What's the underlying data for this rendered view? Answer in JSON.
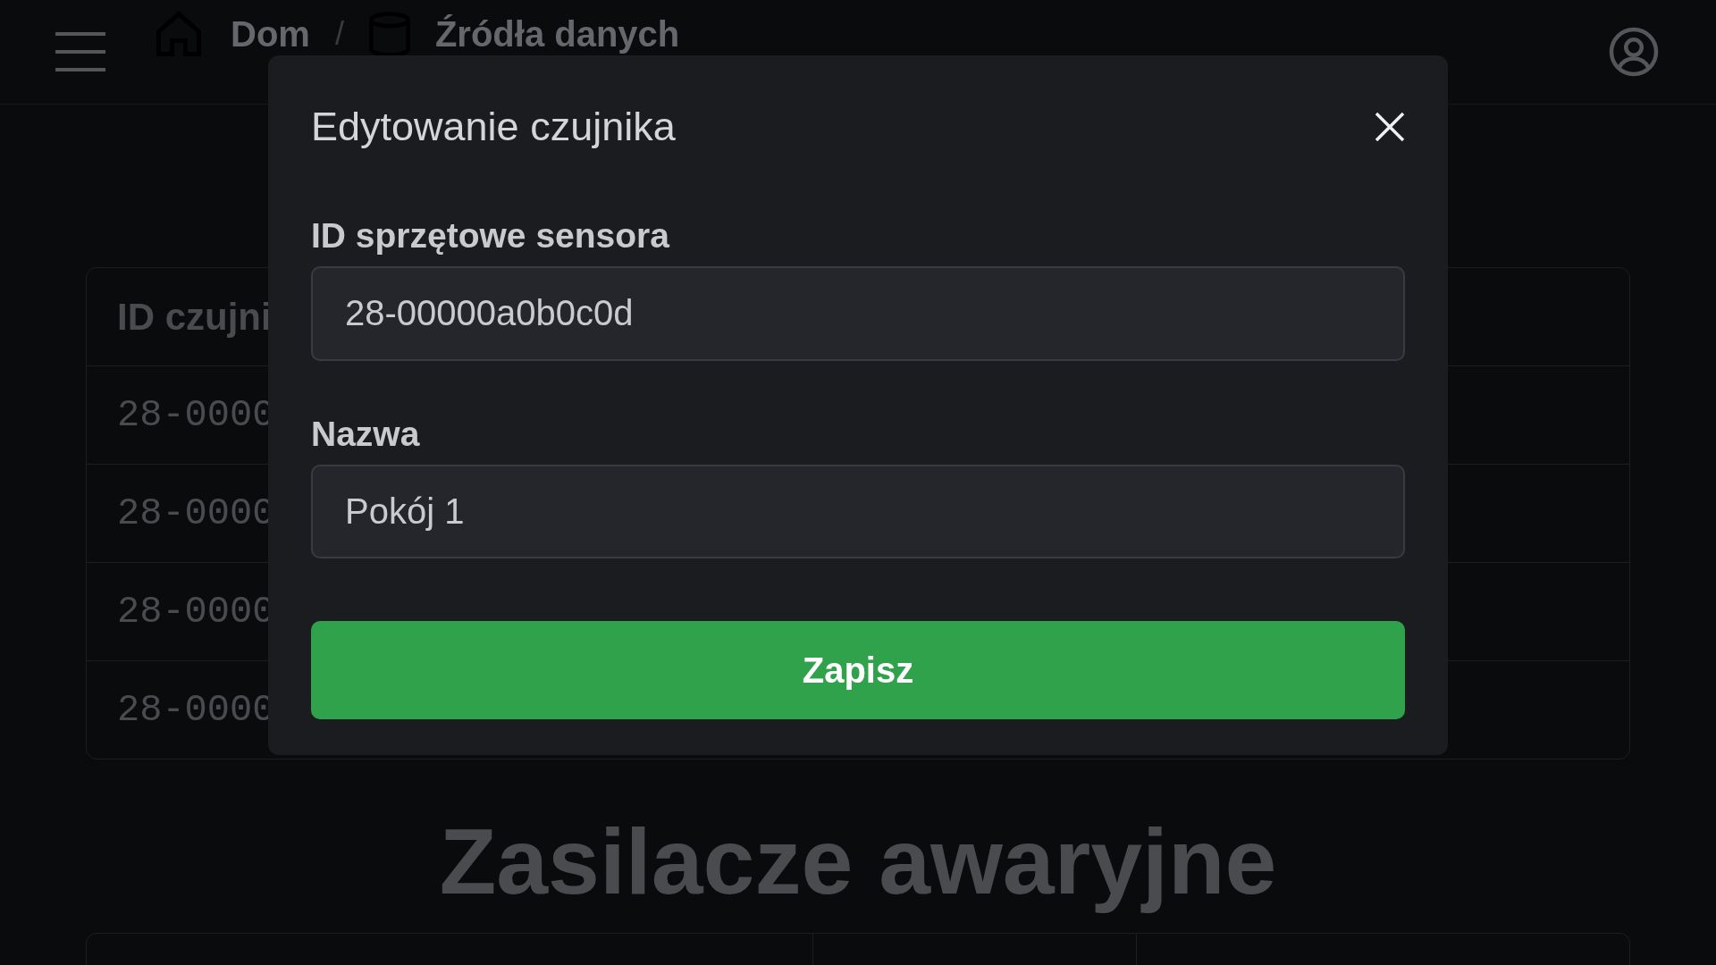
{
  "top_bar": {
    "separator": "/",
    "breadcrumbs": [
      {
        "kind": "home",
        "label": "Dom"
      },
      {
        "kind": "database",
        "label": "Źródła danych"
      }
    ]
  },
  "sensors_table": {
    "columns": [
      "ID czujni"
    ],
    "rows": [
      [
        "28-0000"
      ],
      [
        "28-0000"
      ],
      [
        "28-0000"
      ],
      [
        "28-0000"
      ]
    ]
  },
  "ups_section": {
    "title": "Zasilacze awaryjne"
  },
  "dialog": {
    "title": "Edytowanie czujnika",
    "fields": [
      {
        "label": "ID sprzętowe sensora",
        "value": "28-00000a0b0c0d"
      },
      {
        "label": "Nazwa",
        "value": "Pokój 1"
      }
    ],
    "submit": "Zapisz"
  }
}
